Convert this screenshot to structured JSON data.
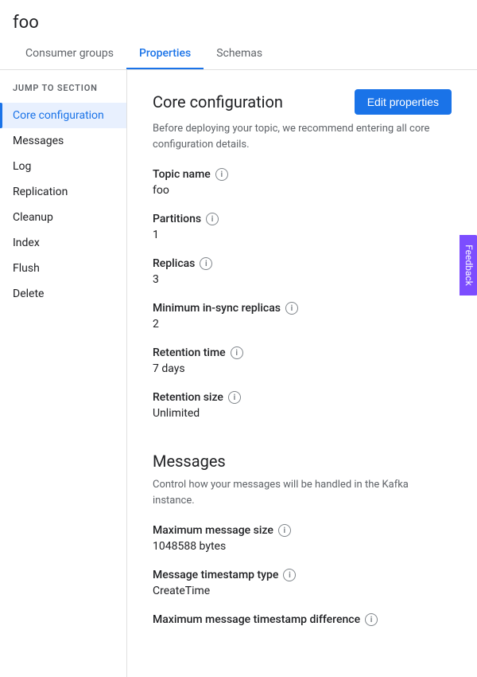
{
  "heading": "foo",
  "tabs": [
    {
      "id": "consumer-groups",
      "label": "Consumer groups",
      "active": false
    },
    {
      "id": "properties",
      "label": "Properties",
      "active": true
    },
    {
      "id": "schemas",
      "label": "Schemas",
      "active": false
    }
  ],
  "sidebar": {
    "heading": "JUMP TO SECTION",
    "items": [
      {
        "id": "core-configuration",
        "label": "Core configuration",
        "active": true
      },
      {
        "id": "messages",
        "label": "Messages",
        "active": false
      },
      {
        "id": "log",
        "label": "Log",
        "active": false
      },
      {
        "id": "replication",
        "label": "Replication",
        "active": false
      },
      {
        "id": "cleanup",
        "label": "Cleanup",
        "active": false
      },
      {
        "id": "index",
        "label": "Index",
        "active": false
      },
      {
        "id": "flush",
        "label": "Flush",
        "active": false
      },
      {
        "id": "delete",
        "label": "Delete",
        "active": false
      }
    ]
  },
  "core_config": {
    "title": "Core configuration",
    "description": "Before deploying your topic, we recommend entering all core configuration details.",
    "edit_button": "Edit properties",
    "fields": [
      {
        "id": "topic-name",
        "label": "Topic name",
        "value": "foo",
        "has_info": true
      },
      {
        "id": "partitions",
        "label": "Partitions",
        "value": "1",
        "has_info": true
      },
      {
        "id": "replicas",
        "label": "Replicas",
        "value": "3",
        "has_info": true
      },
      {
        "id": "min-insync-replicas",
        "label": "Minimum in-sync replicas",
        "value": "2",
        "has_info": true
      },
      {
        "id": "retention-time",
        "label": "Retention time",
        "value": "7 days",
        "has_info": true
      },
      {
        "id": "retention-size",
        "label": "Retention size",
        "value": "Unlimited",
        "has_info": true
      }
    ]
  },
  "messages_config": {
    "title": "Messages",
    "description": "Control how your messages will be handled in the Kafka instance.",
    "fields": [
      {
        "id": "max-message-size",
        "label": "Maximum message size",
        "value": "1048588 bytes",
        "has_info": true
      },
      {
        "id": "message-timestamp-type",
        "label": "Message timestamp type",
        "value": "CreateTime",
        "has_info": true
      },
      {
        "id": "max-message-timestamp-diff",
        "label": "Maximum message timestamp difference",
        "value": "",
        "has_info": true
      }
    ]
  },
  "feedback": "Feedback"
}
